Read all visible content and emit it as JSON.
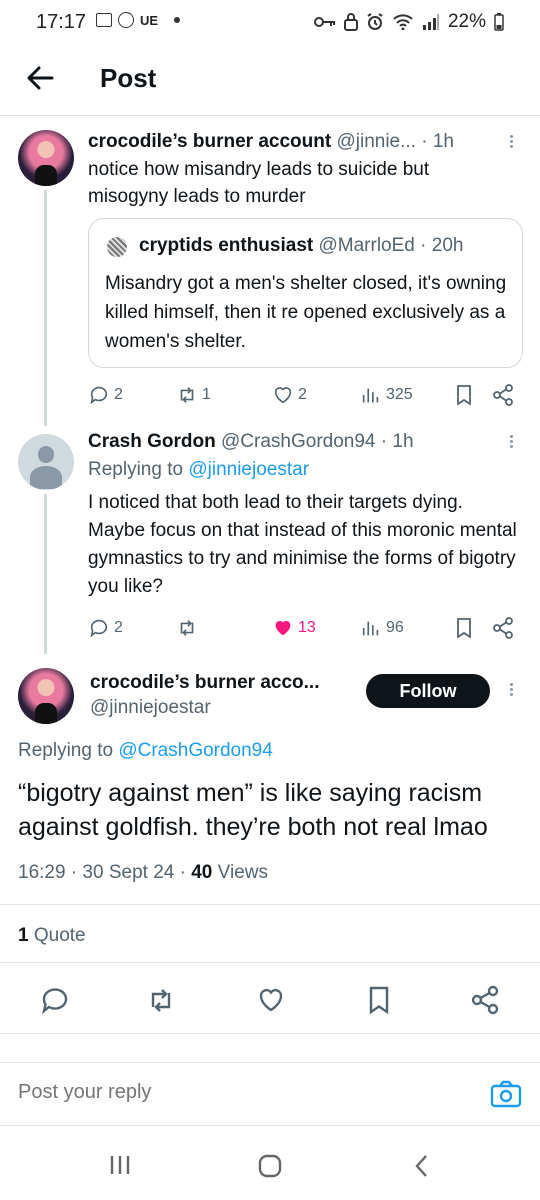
{
  "status_bar": {
    "time": "17:17",
    "carrier": "UE",
    "battery": "22%"
  },
  "header": {
    "title": "Post"
  },
  "tweet1": {
    "name": "crocodile’s burner account",
    "handle": "@jinnie...",
    "time": "· 1h",
    "text": "notice how misandry leads to suicide but misogyny leads to murder",
    "quote": {
      "name": "cryptids enthusiast",
      "handle": "@MarrloEd",
      "time": "· 20h",
      "text": "Misandry got a men's shelter closed, it's owning killed himself, then it re opened exclusively as a women's shelter."
    },
    "actions": {
      "replies": "2",
      "reposts": "1",
      "likes": "2",
      "views": "325"
    }
  },
  "tweet2": {
    "name": "Crash Gordon",
    "handle": "@CrashGordon94",
    "time": "· 1h",
    "replying_prefix": "Replying to",
    "replying_to": "@jinniejoestar",
    "text": "I noticed that both lead to their targets dying. Maybe focus on that instead of this moronic mental gymnastics to try and minimise the forms of bigotry you like?",
    "actions": {
      "replies": "2",
      "reposts": "",
      "likes": "13",
      "views": "96"
    }
  },
  "main_post": {
    "name": "crocodile’s burner acco...",
    "handle": "@jinniejoestar",
    "follow_label": "Follow",
    "replying_prefix": "Replying to",
    "replying_to": "@CrashGordon94",
    "text": "“bigotry against men” is like saying racism against goldfish. they’re both not real lmao",
    "timestamp": "16:29 · 30 Sept 24 ·",
    "views_count": "40",
    "views_label": "Views",
    "quote_count": "1",
    "quote_label": "Quote"
  },
  "reply": {
    "placeholder": "Post your reply"
  },
  "colors": {
    "accent": "#1d9bf0",
    "like": "#f91880",
    "text": "#0f1419",
    "muted": "#536471"
  }
}
